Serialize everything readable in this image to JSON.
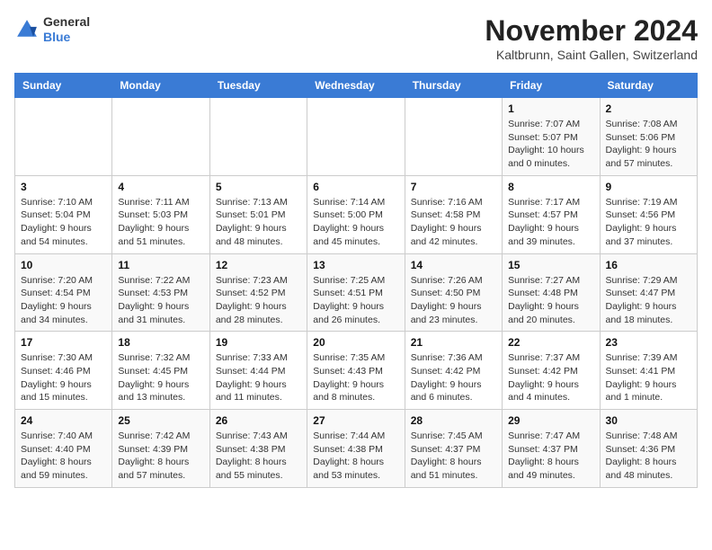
{
  "header": {
    "logo_general": "General",
    "logo_blue": "Blue",
    "month_year": "November 2024",
    "location": "Kaltbrunn, Saint Gallen, Switzerland"
  },
  "days_of_week": [
    "Sunday",
    "Monday",
    "Tuesday",
    "Wednesday",
    "Thursday",
    "Friday",
    "Saturday"
  ],
  "weeks": [
    [
      {
        "day": "",
        "info": ""
      },
      {
        "day": "",
        "info": ""
      },
      {
        "day": "",
        "info": ""
      },
      {
        "day": "",
        "info": ""
      },
      {
        "day": "",
        "info": ""
      },
      {
        "day": "1",
        "info": "Sunrise: 7:07 AM\nSunset: 5:07 PM\nDaylight: 10 hours and 0 minutes."
      },
      {
        "day": "2",
        "info": "Sunrise: 7:08 AM\nSunset: 5:06 PM\nDaylight: 9 hours and 57 minutes."
      }
    ],
    [
      {
        "day": "3",
        "info": "Sunrise: 7:10 AM\nSunset: 5:04 PM\nDaylight: 9 hours and 54 minutes."
      },
      {
        "day": "4",
        "info": "Sunrise: 7:11 AM\nSunset: 5:03 PM\nDaylight: 9 hours and 51 minutes."
      },
      {
        "day": "5",
        "info": "Sunrise: 7:13 AM\nSunset: 5:01 PM\nDaylight: 9 hours and 48 minutes."
      },
      {
        "day": "6",
        "info": "Sunrise: 7:14 AM\nSunset: 5:00 PM\nDaylight: 9 hours and 45 minutes."
      },
      {
        "day": "7",
        "info": "Sunrise: 7:16 AM\nSunset: 4:58 PM\nDaylight: 9 hours and 42 minutes."
      },
      {
        "day": "8",
        "info": "Sunrise: 7:17 AM\nSunset: 4:57 PM\nDaylight: 9 hours and 39 minutes."
      },
      {
        "day": "9",
        "info": "Sunrise: 7:19 AM\nSunset: 4:56 PM\nDaylight: 9 hours and 37 minutes."
      }
    ],
    [
      {
        "day": "10",
        "info": "Sunrise: 7:20 AM\nSunset: 4:54 PM\nDaylight: 9 hours and 34 minutes."
      },
      {
        "day": "11",
        "info": "Sunrise: 7:22 AM\nSunset: 4:53 PM\nDaylight: 9 hours and 31 minutes."
      },
      {
        "day": "12",
        "info": "Sunrise: 7:23 AM\nSunset: 4:52 PM\nDaylight: 9 hours and 28 minutes."
      },
      {
        "day": "13",
        "info": "Sunrise: 7:25 AM\nSunset: 4:51 PM\nDaylight: 9 hours and 26 minutes."
      },
      {
        "day": "14",
        "info": "Sunrise: 7:26 AM\nSunset: 4:50 PM\nDaylight: 9 hours and 23 minutes."
      },
      {
        "day": "15",
        "info": "Sunrise: 7:27 AM\nSunset: 4:48 PM\nDaylight: 9 hours and 20 minutes."
      },
      {
        "day": "16",
        "info": "Sunrise: 7:29 AM\nSunset: 4:47 PM\nDaylight: 9 hours and 18 minutes."
      }
    ],
    [
      {
        "day": "17",
        "info": "Sunrise: 7:30 AM\nSunset: 4:46 PM\nDaylight: 9 hours and 15 minutes."
      },
      {
        "day": "18",
        "info": "Sunrise: 7:32 AM\nSunset: 4:45 PM\nDaylight: 9 hours and 13 minutes."
      },
      {
        "day": "19",
        "info": "Sunrise: 7:33 AM\nSunset: 4:44 PM\nDaylight: 9 hours and 11 minutes."
      },
      {
        "day": "20",
        "info": "Sunrise: 7:35 AM\nSunset: 4:43 PM\nDaylight: 9 hours and 8 minutes."
      },
      {
        "day": "21",
        "info": "Sunrise: 7:36 AM\nSunset: 4:42 PM\nDaylight: 9 hours and 6 minutes."
      },
      {
        "day": "22",
        "info": "Sunrise: 7:37 AM\nSunset: 4:42 PM\nDaylight: 9 hours and 4 minutes."
      },
      {
        "day": "23",
        "info": "Sunrise: 7:39 AM\nSunset: 4:41 PM\nDaylight: 9 hours and 1 minute."
      }
    ],
    [
      {
        "day": "24",
        "info": "Sunrise: 7:40 AM\nSunset: 4:40 PM\nDaylight: 8 hours and 59 minutes."
      },
      {
        "day": "25",
        "info": "Sunrise: 7:42 AM\nSunset: 4:39 PM\nDaylight: 8 hours and 57 minutes."
      },
      {
        "day": "26",
        "info": "Sunrise: 7:43 AM\nSunset: 4:38 PM\nDaylight: 8 hours and 55 minutes."
      },
      {
        "day": "27",
        "info": "Sunrise: 7:44 AM\nSunset: 4:38 PM\nDaylight: 8 hours and 53 minutes."
      },
      {
        "day": "28",
        "info": "Sunrise: 7:45 AM\nSunset: 4:37 PM\nDaylight: 8 hours and 51 minutes."
      },
      {
        "day": "29",
        "info": "Sunrise: 7:47 AM\nSunset: 4:37 PM\nDaylight: 8 hours and 49 minutes."
      },
      {
        "day": "30",
        "info": "Sunrise: 7:48 AM\nSunset: 4:36 PM\nDaylight: 8 hours and 48 minutes."
      }
    ]
  ]
}
